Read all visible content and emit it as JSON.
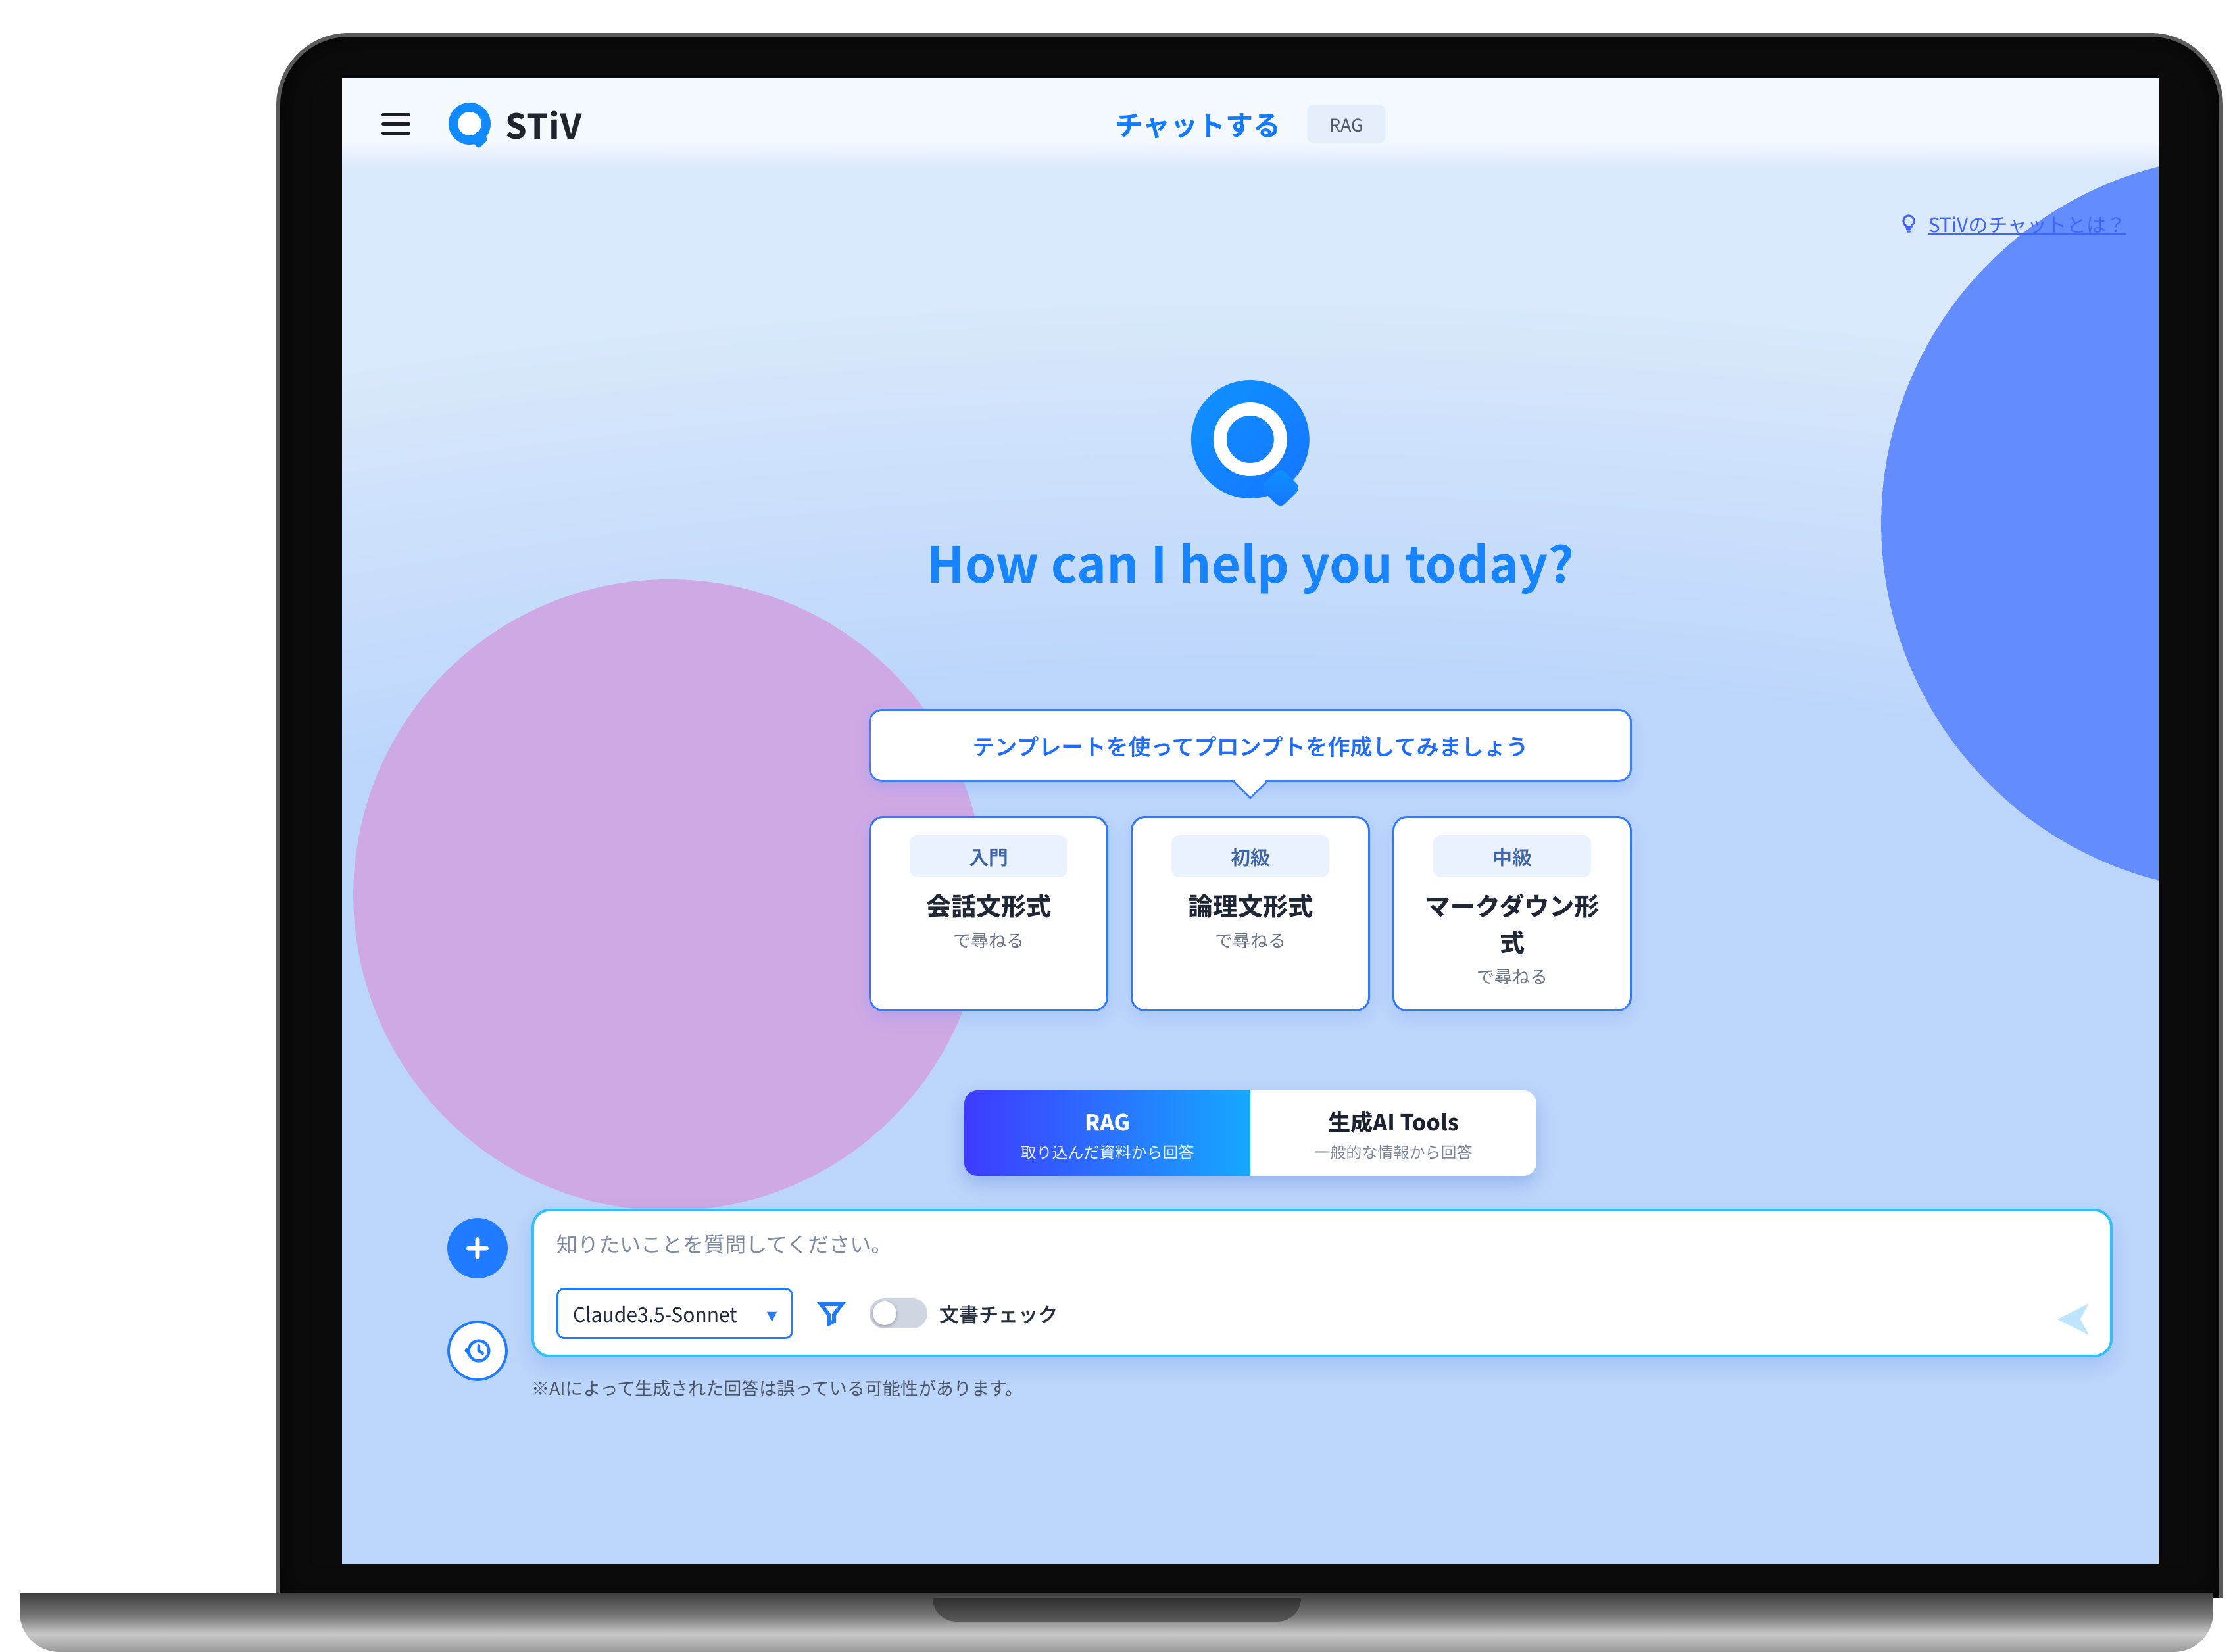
{
  "brand": {
    "name": "STiV"
  },
  "header": {
    "tab_primary": "チャットする",
    "tab_pill": "RAG"
  },
  "help_link": "STiVのチャットとは？",
  "hero": {
    "title": "How can I help you today?"
  },
  "template_prompt": "テンプレートを使ってプロンプトを作成してみましょう",
  "cards": [
    {
      "level": "入門",
      "title": "会話文形式",
      "sub": "で尋ねる"
    },
    {
      "level": "初級",
      "title": "論理文形式",
      "sub": "で尋ねる"
    },
    {
      "level": "中級",
      "title": "マークダウン形式",
      "sub": "で尋ねる"
    }
  ],
  "modes": {
    "active": {
      "title": "RAG",
      "sub": "取り込んだ資料から回答"
    },
    "inactive": {
      "title": "生成AI Tools",
      "sub": "一般的な情報から回答"
    }
  },
  "input": {
    "placeholder": "知りたいことを質問してください。",
    "model_selected": "Claude3.5-Sonnet",
    "doccheck_label": "文書チェック",
    "doccheck_on": false
  },
  "disclaimer": "※AIによって生成された回答は誤っている可能性があります。"
}
